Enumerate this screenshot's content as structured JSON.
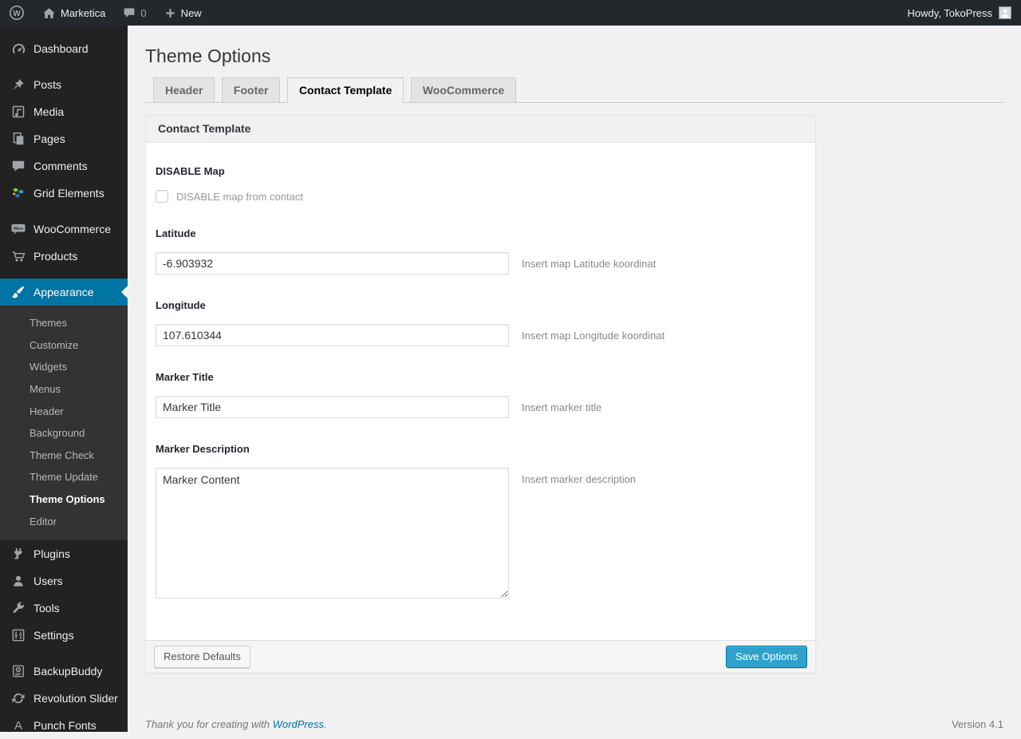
{
  "colors": {
    "accent": "#0074a2",
    "primary_button": "#2ea2cc",
    "admin_bar_bg": "#23282d",
    "sidebar_bg": "#222222",
    "submenu_bg": "#333333",
    "page_bg": "#f1f1f1"
  },
  "admin_bar": {
    "wp_logo_icon": "wordpress-logo-icon",
    "home_icon": "home-icon",
    "site_name": "Marketica",
    "comments_icon": "comment-bubble-icon",
    "comment_count": "0",
    "plus_icon": "plus-icon",
    "new_label": "New",
    "howdy_text": "Howdy, TokoPress",
    "avatar_icon": "avatar-icon"
  },
  "sidebar": {
    "items": [
      {
        "label": "Dashboard",
        "icon": "dashboard-icon"
      },
      {
        "label": "Posts",
        "icon": "pushpin-icon"
      },
      {
        "label": "Media",
        "icon": "media-icon"
      },
      {
        "label": "Pages",
        "icon": "pages-icon"
      },
      {
        "label": "Comments",
        "icon": "comment-icon"
      },
      {
        "label": "Grid Elements",
        "icon": "grid-elements-icon"
      },
      {
        "label": "WooCommerce",
        "icon": "woocommerce-icon"
      },
      {
        "label": "Products",
        "icon": "cart-icon"
      },
      {
        "label": "Appearance",
        "icon": "paintbrush-icon",
        "active": true
      },
      {
        "label": "Plugins",
        "icon": "plugin-icon"
      },
      {
        "label": "Users",
        "icon": "user-icon"
      },
      {
        "label": "Tools",
        "icon": "wrench-icon"
      },
      {
        "label": "Settings",
        "icon": "settings-icon"
      },
      {
        "label": "BackupBuddy",
        "icon": "backup-icon"
      },
      {
        "label": "Revolution Slider",
        "icon": "cycle-arrows-icon"
      },
      {
        "label": "Punch Fonts",
        "icon": "letter-a-icon"
      }
    ],
    "appearance_submenu": [
      "Themes",
      "Customize",
      "Widgets",
      "Menus",
      "Header",
      "Background",
      "Theme Check",
      "Theme Update",
      "Theme Options",
      "Editor"
    ],
    "active_submenu_item": "Theme Options"
  },
  "main": {
    "page_title": "Theme Options",
    "tabs": [
      {
        "label": "Header",
        "active": false
      },
      {
        "label": "Footer",
        "active": false
      },
      {
        "label": "Contact Template",
        "active": true
      },
      {
        "label": "WooCommerce",
        "active": false
      }
    ],
    "panel": {
      "title": "Contact Template",
      "fields": {
        "disable_map": {
          "label": "DISABLE Map",
          "checkbox_label": "DISABLE map from contact",
          "checked": false
        },
        "latitude": {
          "label": "Latitude",
          "value": "-6.903932",
          "help": "Insert map Latitude koordinat"
        },
        "longitude": {
          "label": "Longitude",
          "value": "107.610344",
          "help": "Insert map Longitude koordinat"
        },
        "marker_title": {
          "label": "Marker Title",
          "value": "Marker Title",
          "help": "Insert marker title"
        },
        "marker_description": {
          "label": "Marker Description",
          "value": "Marker Content",
          "help": "Insert marker description"
        }
      },
      "footer": {
        "restore_label": "Restore Defaults",
        "save_label": "Save Options"
      }
    },
    "page_footer": {
      "thanks_prefix": "Thank you for creating with ",
      "wordpress_link": "WordPress",
      "suffix": ".",
      "version": "Version 4.1"
    }
  }
}
